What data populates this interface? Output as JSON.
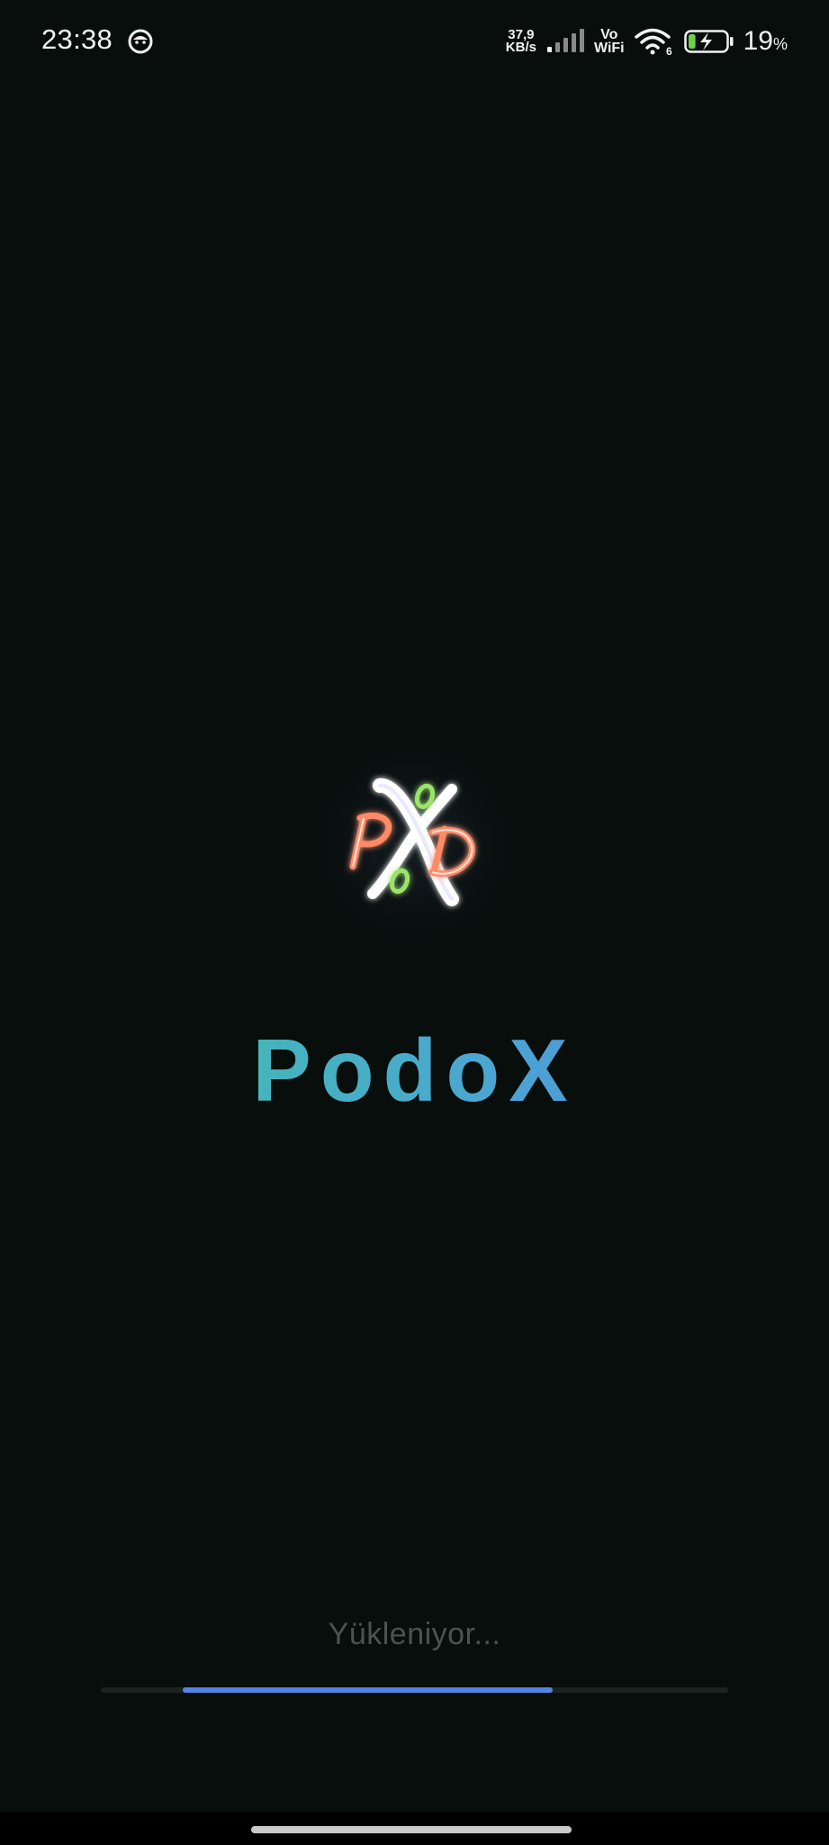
{
  "status_bar": {
    "time": "23:38",
    "notification_icon": "smiley-icon",
    "net_speed_value": "37,9",
    "net_speed_unit": "KB/s",
    "volte_top": "Vo",
    "volte_bottom": "WiFi",
    "wifi_badge": "6",
    "battery_percent": "19",
    "battery_percent_sign": "%",
    "battery_level": 0.19,
    "icons": [
      "signal-icon",
      "wifi-icon",
      "battery-charging-icon"
    ]
  },
  "logo": {
    "icon": "podox-neon-logo",
    "colors": {
      "p": "#ff8a66",
      "x": "#ffffff",
      "d": "#ff8a66",
      "o": "#9be36b"
    }
  },
  "app": {
    "title": "PodoX",
    "gradient": [
      "#3fc3a3",
      "#4aa8cf",
      "#5586ea"
    ]
  },
  "loading": {
    "text": "Yükleniyor...",
    "progress_start": 0.13,
    "progress_end": 0.72,
    "bar_color": "#5585e4"
  }
}
